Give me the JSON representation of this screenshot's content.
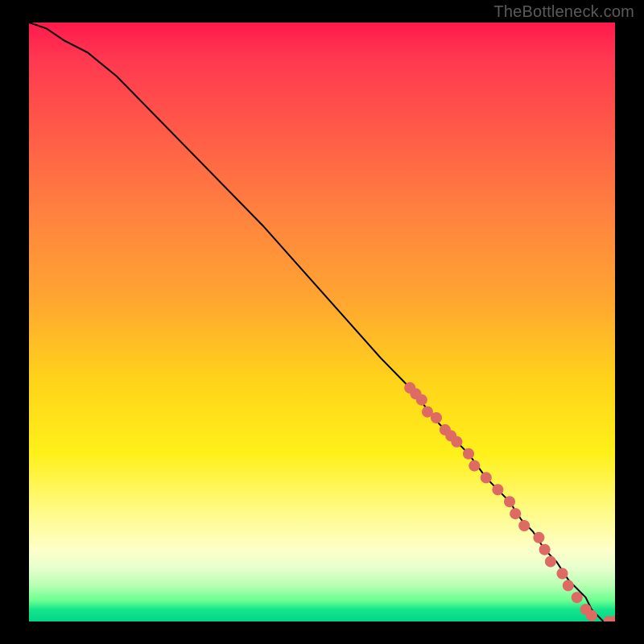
{
  "watermark": "TheBottleneck.com",
  "chart_data": {
    "type": "line",
    "title": "",
    "xlabel": "",
    "ylabel": "",
    "xlim": [
      0,
      100
    ],
    "ylim": [
      0,
      100
    ],
    "grid": false,
    "legend": false,
    "background_gradient_stops": [
      {
        "pos": 0,
        "color": "#ff1a4d"
      },
      {
        "pos": 18,
        "color": "#ff5a48"
      },
      {
        "pos": 46,
        "color": "#ffa531"
      },
      {
        "pos": 72,
        "color": "#fff01a"
      },
      {
        "pos": 88,
        "color": "#fdffc8"
      },
      {
        "pos": 96,
        "color": "#6cff91"
      },
      {
        "pos": 100,
        "color": "#00d68a"
      }
    ],
    "series": [
      {
        "name": "bottleneck-curve",
        "note": "monotone decreasing curve; gentle concave bend at top-left, near-linear diagonal, flattens to zero at far right",
        "x": [
          0,
          3,
          6,
          10,
          15,
          20,
          30,
          40,
          50,
          60,
          65,
          70,
          75,
          78,
          80,
          82,
          84,
          86,
          88,
          90,
          92,
          93,
          94,
          95,
          96,
          97,
          98,
          99,
          100
        ],
        "y": [
          100,
          99,
          97,
          95,
          91,
          86,
          76,
          66,
          55,
          44,
          39,
          33,
          28,
          24,
          22,
          20,
          17,
          15,
          12,
          10,
          7,
          6,
          5,
          4,
          2,
          1,
          0,
          0,
          0
        ]
      }
    ],
    "markers": {
      "name": "highlighted-points",
      "color": "#dd6b63",
      "radius_px": 7,
      "note": "cluster of circular markers along the lower-right portion of the curve",
      "points": [
        {
          "x": 65,
          "y": 39
        },
        {
          "x": 66,
          "y": 38
        },
        {
          "x": 67,
          "y": 37
        },
        {
          "x": 68,
          "y": 35
        },
        {
          "x": 69.5,
          "y": 34
        },
        {
          "x": 71,
          "y": 32
        },
        {
          "x": 72,
          "y": 31
        },
        {
          "x": 73,
          "y": 30
        },
        {
          "x": 75,
          "y": 28
        },
        {
          "x": 76,
          "y": 26
        },
        {
          "x": 78,
          "y": 24
        },
        {
          "x": 80,
          "y": 22
        },
        {
          "x": 82,
          "y": 20
        },
        {
          "x": 83,
          "y": 18
        },
        {
          "x": 84.5,
          "y": 16
        },
        {
          "x": 87,
          "y": 14
        },
        {
          "x": 88,
          "y": 12
        },
        {
          "x": 89,
          "y": 10
        },
        {
          "x": 91,
          "y": 8
        },
        {
          "x": 92,
          "y": 6
        },
        {
          "x": 93.5,
          "y": 4
        },
        {
          "x": 95,
          "y": 2
        },
        {
          "x": 96,
          "y": 1
        },
        {
          "x": 99,
          "y": 0
        },
        {
          "x": 100,
          "y": 0
        }
      ]
    }
  }
}
